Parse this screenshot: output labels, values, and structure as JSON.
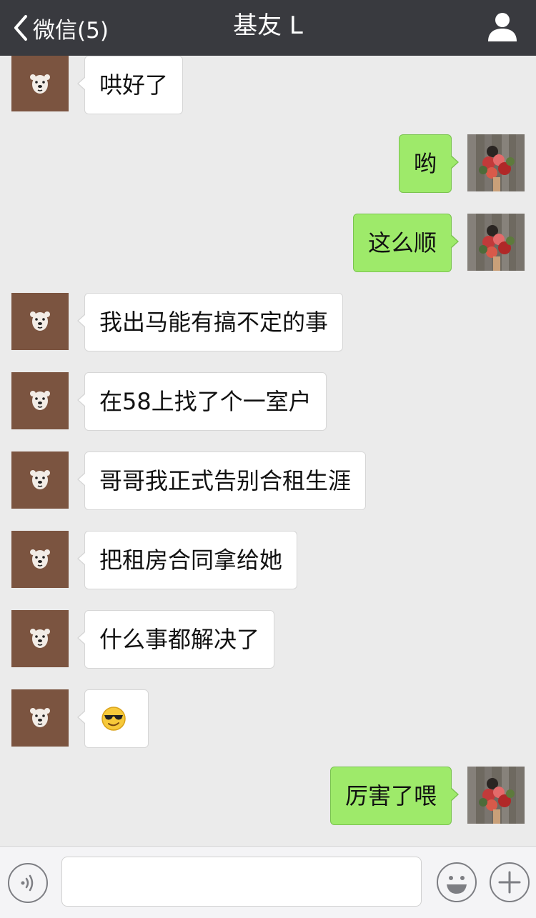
{
  "header": {
    "back_label": "微信(5)",
    "title": "基友 L"
  },
  "messages": [
    {
      "side": "left",
      "text": "哄好了"
    },
    {
      "side": "right",
      "text": "哟"
    },
    {
      "side": "right",
      "text": "这么顺"
    },
    {
      "side": "left",
      "text": "我出马能有搞不定的事"
    },
    {
      "side": "left",
      "text": "在58上找了个一室户"
    },
    {
      "side": "left",
      "text": "哥哥我正式告别合租生涯"
    },
    {
      "side": "left",
      "text": "把租房合同拿给她"
    },
    {
      "side": "left",
      "text": "什么事都解决了"
    },
    {
      "side": "left",
      "emoji": "cool-sunglasses-emoji"
    },
    {
      "side": "right",
      "text": "厉害了喂"
    }
  ],
  "input": {
    "value": "",
    "placeholder": ""
  },
  "icons": {
    "back": "chevron-left-icon",
    "profile": "person-icon",
    "voice": "voice-icon",
    "emoji": "smiley-icon",
    "more": "plus-icon"
  },
  "colors": {
    "navbar": "#393a3f",
    "background": "#ebebeb",
    "sent_bubble": "#9eea6a",
    "received_bubble": "#ffffff"
  }
}
